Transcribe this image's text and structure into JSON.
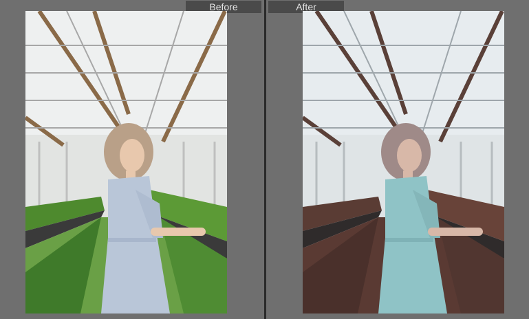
{
  "window": {
    "background": "#6f6f6f"
  },
  "compare": {
    "before_label": "Before",
    "after_label": "After",
    "before_photo": {
      "subject": "woman-in-greenhouse",
      "sky": "#eef0f0",
      "beam": "#8a6a48",
      "foliage": "#4e8a2e",
      "floor": "#6aa046",
      "dress": "#b9c6d8",
      "hair": "#b9a088"
    },
    "after_photo": {
      "subject": "woman-in-greenhouse",
      "sky": "#e7ecef",
      "beam": "#5a4038",
      "foliage": "#5a3c34",
      "floor": "#5a3a33",
      "dress": "#8fc3c6",
      "hair": "#9f8a88"
    }
  }
}
